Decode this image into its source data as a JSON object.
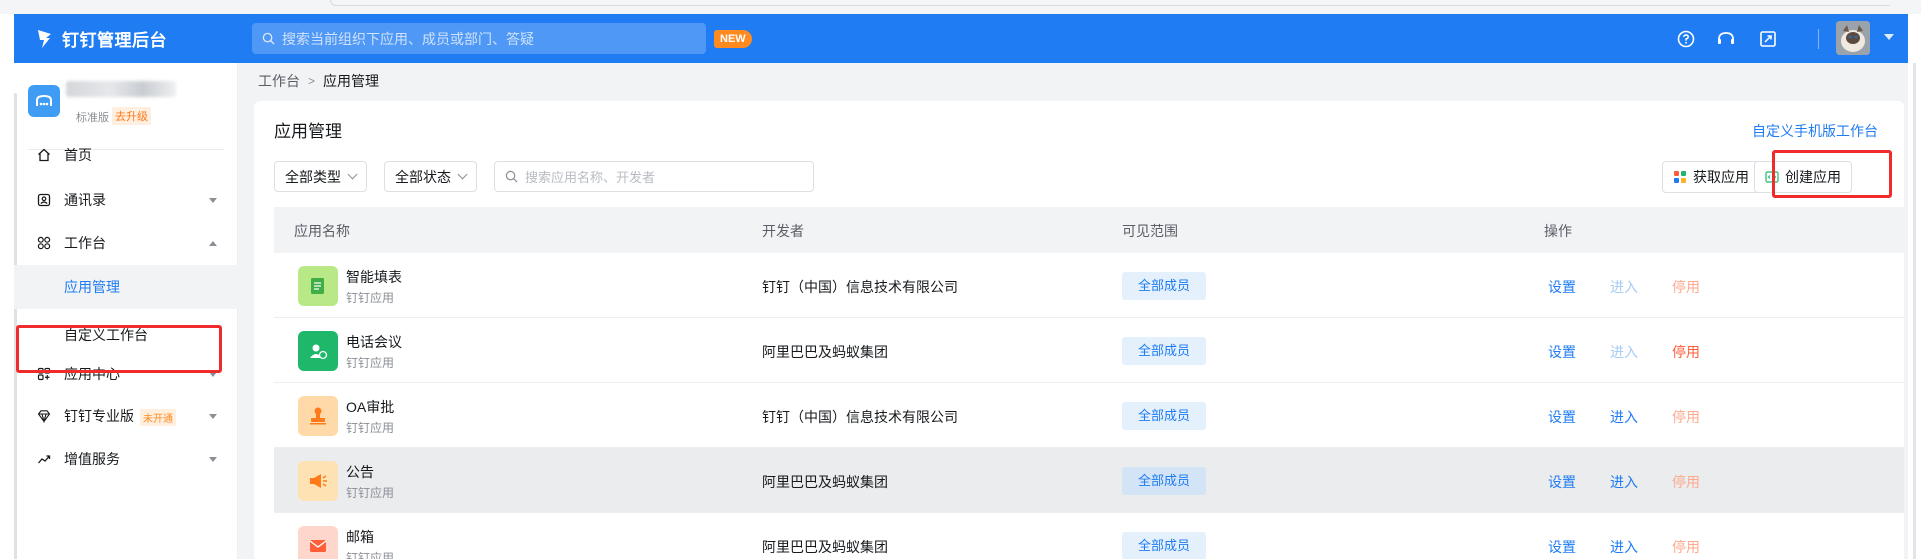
{
  "header": {
    "brand": "钉钉管理后台",
    "search_placeholder": "搜索当前组织下应用、成员或部门、答疑",
    "new_badge": "NEW"
  },
  "sidebar": {
    "org_version": "标准版",
    "org_upgrade": "去升级",
    "items": [
      {
        "label": "首页",
        "icon": "home-icon"
      },
      {
        "label": "通讯录",
        "icon": "contacts-icon"
      },
      {
        "label": "工作台",
        "icon": "workbench-icon"
      },
      {
        "label": "应用管理"
      },
      {
        "label": "自定义工作台"
      },
      {
        "label": "应用中心",
        "icon": "app-center-icon"
      },
      {
        "label": "钉钉专业版",
        "icon": "diamond-icon",
        "badge": "未开通"
      },
      {
        "label": "增值服务",
        "icon": "trend-icon"
      }
    ]
  },
  "breadcrumb": {
    "root": "工作台",
    "separator": ">",
    "current": "应用管理"
  },
  "page": {
    "title": "应用管理",
    "custom_mobile_link": "自定义手机版工作台",
    "filter_type": "全部类型",
    "filter_status": "全部状态",
    "search_placeholder": "搜索应用名称、开发者",
    "get_app_button": "获取应用",
    "create_app_button": "创建应用"
  },
  "table": {
    "columns": [
      "应用名称",
      "开发者",
      "可见范围",
      "操作"
    ],
    "rows": [
      {
        "name": "智能填表",
        "sub": "钉钉应用",
        "developer": "钉钉（中国）信息技术有限公司",
        "scope": "全部成员",
        "op_settings": "设置",
        "op_enter": "进入",
        "op_disable": "停用",
        "icon_color": "#b8e986"
      },
      {
        "name": "电话会议",
        "sub": "钉钉应用",
        "developer": "阿里巴巴及蚂蚁集团",
        "scope": "全部成员",
        "op_settings": "设置",
        "op_enter": "进入",
        "op_disable": "停用",
        "icon_color": "#1fb86a"
      },
      {
        "name": "OA审批",
        "sub": "钉钉应用",
        "developer": "钉钉（中国）信息技术有限公司",
        "scope": "全部成员",
        "op_settings": "设置",
        "op_enter": "进入",
        "op_disable": "停用",
        "icon_color": "#ffd9a8"
      },
      {
        "name": "公告",
        "sub": "钉钉应用",
        "developer": "阿里巴巴及蚂蚁集团",
        "scope": "全部成员",
        "op_settings": "设置",
        "op_enter": "进入",
        "op_disable": "停用",
        "icon_color": "#ffe2b3"
      },
      {
        "name": "邮箱",
        "sub": "钉钉应用",
        "developer": "阿里巴巴及蚂蚁集团",
        "scope": "全部成员",
        "op_settings": "设置",
        "op_enter": "进入",
        "op_disable": "停用",
        "icon_color": "#ffd6cc"
      }
    ]
  },
  "colors": {
    "brand_blue": "#1f7cf2",
    "highlight_red": "#f02b2b"
  }
}
